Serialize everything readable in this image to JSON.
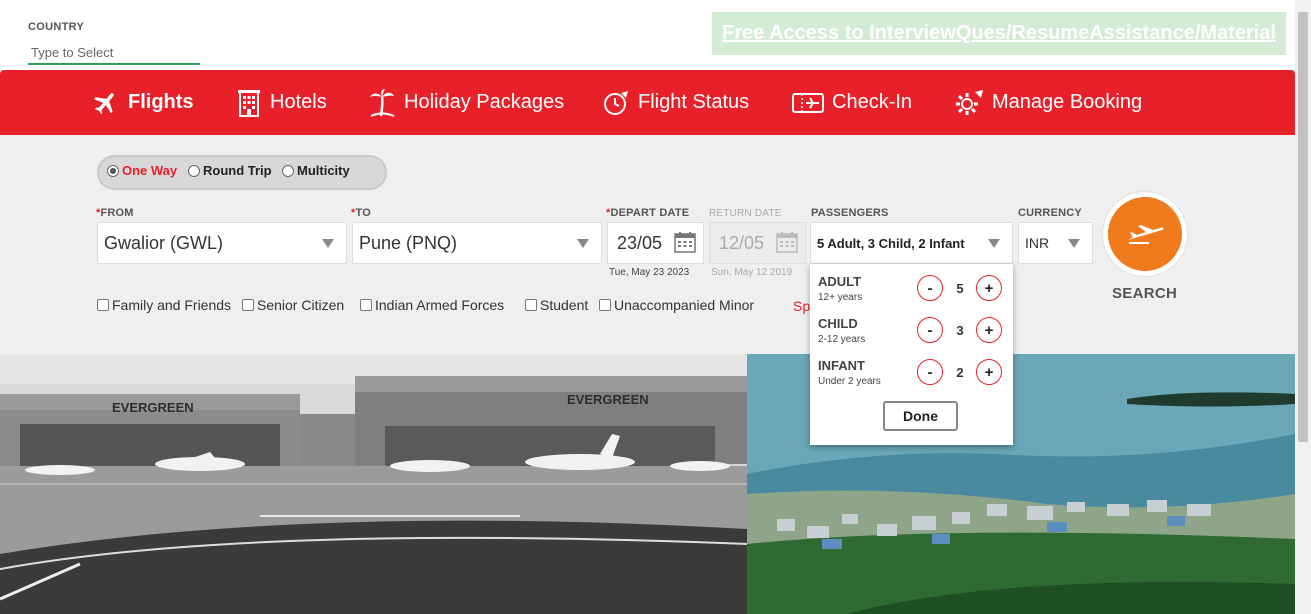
{
  "country": {
    "label": "COUNTRY",
    "placeholder": "Type to Select"
  },
  "promo": {
    "text": "Free Access to InterviewQues/ResumeAssistance/Material"
  },
  "nav": {
    "flights": "Flights",
    "hotels": "Hotels",
    "holiday": "Holiday Packages",
    "flight_status": "Flight Status",
    "checkin": "Check-In",
    "manage": "Manage Booking"
  },
  "trip": {
    "one_way": "One Way",
    "round_trip": "Round Trip",
    "multicity": "Multicity",
    "selected": "One Way"
  },
  "form": {
    "from_label": "FROM",
    "from_value": "Gwalior (GWL)",
    "to_label": "TO",
    "to_value": "Pune (PNQ)",
    "depart_label": "DEPART DATE",
    "depart_value": "23/05",
    "depart_sub": "Tue, May 23 2023",
    "return_label": "RETURN DATE",
    "return_value": "12/05",
    "return_sub": "Sun, May 12 2019",
    "pax_label": "PASSENGERS",
    "pax_value": "5 Adult, 3 Child, 2 Infant",
    "currency_label": "CURRENCY",
    "currency_value": "INR",
    "search_label": "SEARCH"
  },
  "options": {
    "family": "Family and Friends",
    "senior": "Senior Citizen",
    "armed": "Indian Armed Forces",
    "student": "Student",
    "minor": "Unaccompanied Minor",
    "partial": "Sp"
  },
  "passengers": {
    "adult_label": "ADULT",
    "adult_sub": "12+ years",
    "adult_count": "5",
    "child_label": "CHILD",
    "child_sub": "2-12 years",
    "child_count": "3",
    "infant_label": "INFANT",
    "infant_sub": "Under 2 years",
    "infant_count": "2",
    "minus": "-",
    "plus": "+",
    "done": "Done"
  },
  "images": {
    "left_sign_1": "EVERGREEN",
    "left_sign_2": "EVERGREEN"
  },
  "colors": {
    "brand_red": "#e8202a",
    "search_orange": "#f07b1c",
    "promo_bg": "#d4ecd4",
    "country_underline": "#2e9a5a"
  }
}
